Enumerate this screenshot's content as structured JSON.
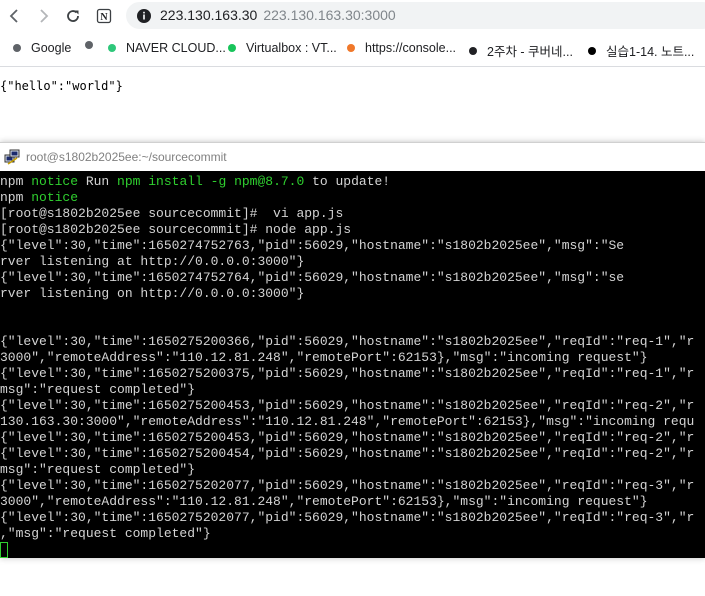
{
  "browser": {
    "address": {
      "host": "223.130.163.30",
      "full_url": "223.130.163.30:3000"
    },
    "icons": {
      "back": "back-arrow-icon",
      "forward": "forward-arrow-icon",
      "reload": "reload-icon",
      "notion": "notion-icon",
      "info": "info-icon"
    },
    "bookmarks": [
      {
        "label": "Google",
        "color": "#5f6368"
      },
      {
        "label": "",
        "color": "#5f6368"
      },
      {
        "label": "NAVER CLOUD...",
        "color": "#2ec77a"
      },
      {
        "label": "Virtualbox : VT...",
        "color": "#18c45a"
      },
      {
        "label": "https://console...",
        "color": "#f0782a"
      },
      {
        "label": "2주차 - 쿠버네...",
        "color": "#202124"
      },
      {
        "label": "실습1-14. 노트...",
        "color": "#000000"
      }
    ]
  },
  "page": {
    "json_response": "{\"hello\":\"world\"}"
  },
  "putty": {
    "title": "root@s1802b2025ee:~/sourcecommit",
    "icon": "putty-icon",
    "lines": [
      [
        {
          "t": "npm "
        },
        {
          "t": "notice",
          "g": true
        },
        {
          "t": " Run "
        },
        {
          "t": "npm install -g npm@8.7.0",
          "g": true
        },
        {
          "t": " to update!"
        }
      ],
      [
        {
          "t": "npm "
        },
        {
          "t": "notice",
          "g": true
        }
      ],
      [
        {
          "t": "[root@s1802b2025ee sourcecommit]#  vi app.js"
        }
      ],
      [
        {
          "t": "[root@s1802b2025ee sourcecommit]# node app.js"
        }
      ],
      [
        {
          "t": "{\"level\":30,\"time\":1650274752763,\"pid\":56029,\"hostname\":\"s1802b2025ee\",\"msg\":\"Se"
        }
      ],
      [
        {
          "t": "rver listening at http://0.0.0.0:3000\"}"
        }
      ],
      [
        {
          "t": "{\"level\":30,\"time\":1650274752764,\"pid\":56029,\"hostname\":\"s1802b2025ee\",\"msg\":\"se"
        }
      ],
      [
        {
          "t": "rver listening on http://0.0.0.0:3000\"}"
        }
      ],
      [
        {
          "t": ""
        }
      ],
      [
        {
          "t": ""
        }
      ],
      [
        {
          "t": "{\"level\":30,\"time\":1650275200366,\"pid\":56029,\"hostname\":\"s1802b2025ee\",\"reqId\":\"req-1\",\"r"
        }
      ],
      [
        {
          "t": "3000\",\"remoteAddress\":\"110.12.81.248\",\"remotePort\":62153},\"msg\":\"incoming request\"}"
        }
      ],
      [
        {
          "t": "{\"level\":30,\"time\":1650275200375,\"pid\":56029,\"hostname\":\"s1802b2025ee\",\"reqId\":\"req-1\",\"r"
        }
      ],
      [
        {
          "t": "msg\":\"request completed\"}"
        }
      ],
      [
        {
          "t": "{\"level\":30,\"time\":1650275200453,\"pid\":56029,\"hostname\":\"s1802b2025ee\",\"reqId\":\"req-2\",\"r"
        }
      ],
      [
        {
          "t": "130.163.30:3000\",\"remoteAddress\":\"110.12.81.248\",\"remotePort\":62153},\"msg\":\"incoming requ"
        }
      ],
      [
        {
          "t": "{\"level\":30,\"time\":1650275200453,\"pid\":56029,\"hostname\":\"s1802b2025ee\",\"reqId\":\"req-2\",\"r"
        }
      ],
      [
        {
          "t": "{\"level\":30,\"time\":1650275200454,\"pid\":56029,\"hostname\":\"s1802b2025ee\",\"reqId\":\"req-2\",\"r"
        }
      ],
      [
        {
          "t": "msg\":\"request completed\"}"
        }
      ],
      [
        {
          "t": "{\"level\":30,\"time\":1650275202077,\"pid\":56029,\"hostname\":\"s1802b2025ee\",\"reqId\":\"req-3\",\"r"
        }
      ],
      [
        {
          "t": "3000\",\"remoteAddress\":\"110.12.81.248\",\"remotePort\":62153},\"msg\":\"incoming request\"}"
        }
      ],
      [
        {
          "t": "{\"level\":30,\"time\":1650275202077,\"pid\":56029,\"hostname\":\"s1802b2025ee\",\"reqId\":\"req-3\",\"r"
        }
      ],
      [
        {
          "t": ",\"msg\":\"request completed\"}"
        }
      ]
    ]
  }
}
